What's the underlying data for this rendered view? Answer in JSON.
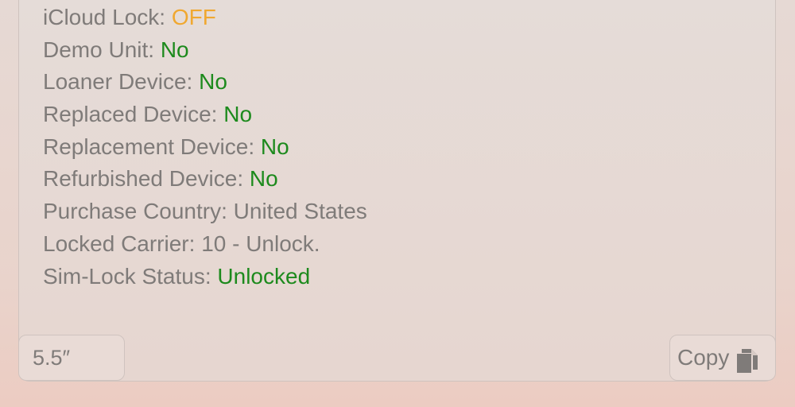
{
  "info": [
    {
      "label": "iCloud Lock: ",
      "value": "OFF",
      "status": "warn"
    },
    {
      "label": "Demo Unit: ",
      "value": "No",
      "status": "ok"
    },
    {
      "label": "Loaner Device: ",
      "value": "No",
      "status": "ok"
    },
    {
      "label": "Replaced Device: ",
      "value": "No",
      "status": "ok"
    },
    {
      "label": "Replacement Device: ",
      "value": "No",
      "status": "ok"
    },
    {
      "label": "Refurbished Device: ",
      "value": "No",
      "status": "ok"
    },
    {
      "label": "Purchase Country: ",
      "value": "United States",
      "status": "plain"
    },
    {
      "label": "Locked Carrier: ",
      "value": "10 - Unlock.",
      "status": "plain"
    },
    {
      "label": "Sim-Lock Status: ",
      "value": "Unlocked",
      "status": "ok"
    }
  ],
  "footer": {
    "size_value": "5.5″",
    "copy_label": "Copy",
    "copy_icon": "copy-icon"
  },
  "colors": {
    "label": "#7f7b79",
    "warn": "#f0a830",
    "ok": "#1d8a1d"
  }
}
